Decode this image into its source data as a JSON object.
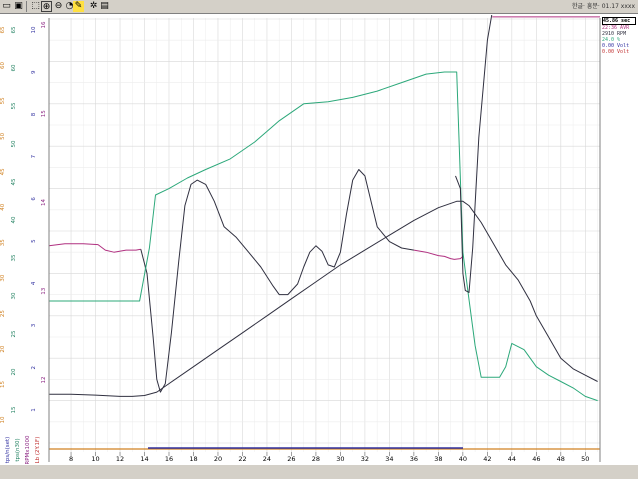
{
  "toolbar": {
    "icons": [
      "open-icon",
      "save-icon",
      "zoom-region-icon",
      "zoom-in-icon",
      "zoom-out-icon",
      "refresh-icon",
      "marker-icon",
      "settings-icon",
      "grid-icon"
    ],
    "status_text": "한글·  흥분· 01.17 xxxx"
  },
  "colors": {
    "background": "#ffffff",
    "grid": "#d8d8d8",
    "series_pink": "#b03080",
    "series_green": "#2ca87a",
    "series_black": "#303040",
    "axis_orange": "#d08020",
    "axis_green": "#208060",
    "axis_blue": "#3030a0",
    "axis_purple": "#8a2080",
    "axis_red": "#c03030"
  },
  "left_axes": {
    "col1_labels": [
      "10",
      "15",
      "20",
      "25",
      "30",
      "35",
      "40",
      "45",
      "50",
      "55",
      "60",
      "65"
    ],
    "col2_labels": [
      "15",
      "20",
      "25",
      "30",
      "35",
      "40",
      "45",
      "50",
      "55",
      "60",
      "65"
    ],
    "col3_labels": [
      "1",
      "2",
      "3",
      "4",
      "5",
      "6",
      "7",
      "8",
      "9",
      "10"
    ],
    "col4_labels": [
      "12",
      "13",
      "14",
      "15",
      "16"
    ],
    "bottom_titles": [
      "tps/n(set)",
      "tps(n30)",
      "RPMx1000",
      "Lb (2Y.1F)"
    ]
  },
  "readout": {
    "time": "45.86 sec",
    "line1": "22:36 AVR",
    "line2": "2910 RPM",
    "line3": "24.0 %",
    "line4": "0.00 Volt",
    "line5": "0.00 Volt"
  },
  "chart_data": {
    "type": "line",
    "x_ticks": [
      8,
      10,
      12,
      14,
      16,
      18,
      20,
      22,
      24,
      26,
      28,
      30,
      32,
      34,
      36,
      38,
      40,
      42,
      44,
      46,
      48,
      50
    ],
    "xlim": [
      6.2,
      51.2
    ],
    "ylim": [
      0,
      100
    ],
    "grid": true,
    "series": [
      {
        "color": "#b03080",
        "x": [
          6.2,
          7.5,
          9.0,
          10.2,
          10.8,
          11.5,
          12.5,
          13.3,
          13.7
        ],
        "y": [
          46.5,
          47,
          47,
          46.8,
          45.5,
          45,
          45.5,
          45.5,
          45.7
        ]
      },
      {
        "color": "#303040",
        "x": [
          13.7,
          14.2,
          14.7,
          15.0,
          15.3,
          15.7,
          16.2,
          16.8,
          17.3,
          17.8,
          18.3,
          19.0,
          19.7,
          20.5,
          21.5,
          22.5,
          23.5,
          24.5,
          25.0,
          25.7,
          26.5,
          27.0,
          27.5,
          28.0,
          28.5,
          29.0,
          29.5,
          30.0,
          30.5,
          31.0,
          31.5,
          32.0,
          32.5,
          33.0,
          34.0,
          35.0,
          36.0
        ],
        "y": [
          45.7,
          40,
          25,
          15,
          12,
          14,
          26,
          43,
          56,
          61,
          62,
          61,
          57,
          51,
          48.5,
          45,
          41.5,
          37,
          35,
          35,
          37.5,
          41.5,
          45,
          46.5,
          45.2,
          42,
          41.5,
          45,
          54,
          62,
          64.5,
          63,
          57,
          51,
          47.5,
          46,
          45.5
        ]
      },
      {
        "color": "#b03080",
        "x": [
          36.0,
          37.0,
          38.0,
          38.5,
          39.0,
          39.3,
          39.8,
          40.0
        ],
        "y": [
          45.5,
          45,
          44.2,
          44,
          43.5,
          43.3,
          43.5,
          44
        ]
      },
      {
        "color": "#2ca87a",
        "x": [
          6.2,
          10.0,
          12.0,
          13.6,
          14.4,
          14.9,
          16.0,
          17.5,
          19.0,
          21.0,
          23.0,
          25.0,
          27.0,
          29.0,
          31.0,
          33.0,
          35.0,
          37.0,
          38.5,
          39.5,
          40.0,
          40.4,
          41.0,
          41.5,
          42.5,
          43.0,
          43.5,
          44.0,
          45.0,
          46.0,
          47.0,
          48.0,
          49.0,
          50.0,
          51.0
        ],
        "y": [
          33.5,
          33.5,
          33.5,
          33.5,
          46,
          58.5,
          60,
          62.5,
          64.5,
          67,
          71,
          76,
          80,
          80.5,
          81.5,
          83,
          85,
          87,
          87.5,
          87.5,
          45,
          36,
          23,
          15.5,
          15.5,
          15.5,
          18,
          23.5,
          22,
          18,
          16,
          14.5,
          13,
          11,
          10
        ]
      },
      {
        "color": "#303040",
        "x": [
          6.2,
          8.0,
          10.0,
          12.0,
          13.0,
          14.0,
          15.0,
          16.0,
          18.0,
          20.0,
          22.0,
          24.0,
          26.0,
          28.0,
          30.0,
          32.0,
          34.0,
          36.0,
          38.0,
          39.5,
          40.0,
          40.5,
          41.5,
          42.5,
          43.5,
          44.5,
          45.5,
          46.0,
          47.0,
          48.0,
          49.0,
          50.0,
          51.0
        ],
        "y": [
          11.5,
          11.5,
          11.3,
          11,
          11,
          11.2,
          12,
          14,
          18,
          22,
          26,
          30,
          34,
          38,
          42,
          45.5,
          49,
          52.5,
          55.5,
          57,
          57,
          56,
          52,
          47,
          42,
          38.5,
          33.5,
          30,
          25,
          20,
          17.5,
          16,
          14.5
        ]
      },
      {
        "color": "#303040",
        "x": [
          39.4,
          39.8,
          40.0,
          40.2,
          40.5,
          40.8,
          41.3,
          42.0,
          42.6
        ],
        "y": [
          63,
          60,
          40,
          36,
          35.5,
          46,
          72,
          95,
          105
        ]
      },
      {
        "color": "#b03080",
        "x": [
          42.4,
          46.0,
          48.0,
          50.0,
          51.2
        ],
        "y": [
          100.5,
          100.5,
          100.5,
          100.5,
          100.5
        ]
      }
    ]
  }
}
